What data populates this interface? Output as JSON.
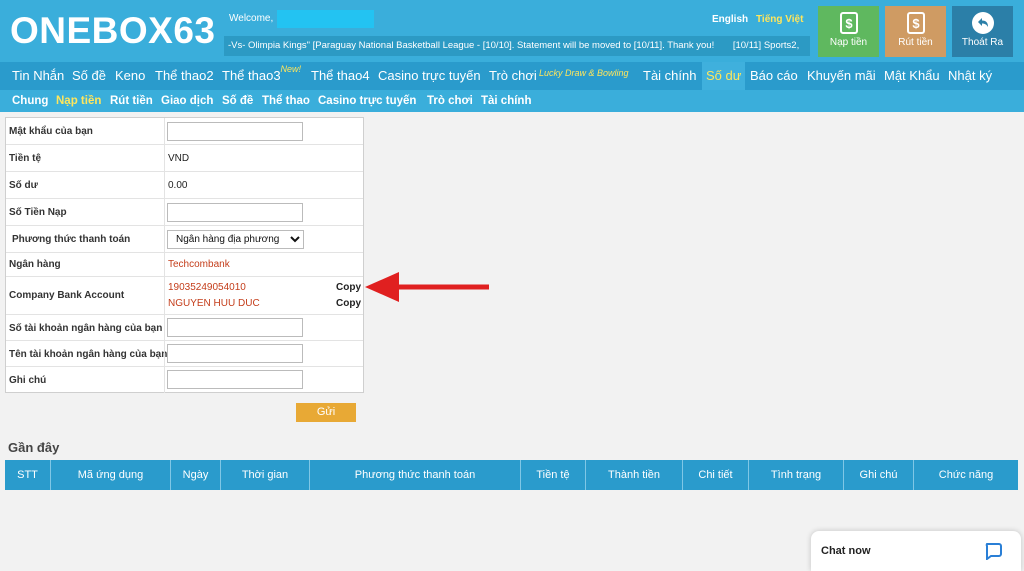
{
  "header": {
    "logo": "ONEBOX63",
    "welcome": "Welcome,",
    "ticker": [
      "-Vs- Olimpia Kings\" [Paraguay National Basketball League - [10/10]. Statement will be moved to [10/11]. Thank you!",
      "[10/11] Sports2,"
    ],
    "lang_en": "English",
    "lang_vi": "Tiếng Việt",
    "buttons": {
      "deposit": "Nạp tiền",
      "withdraw": "Rút tiền",
      "logout": "Thoát Ra"
    }
  },
  "nav1": {
    "items": [
      "Tin Nhắn",
      "Số đề",
      "Keno",
      "Thể thao2",
      "Thể thao3",
      "Thể thao4",
      "Casino trực tuyến",
      "Trò chơi",
      "Tài chính",
      "Số dư",
      "Báo cáo",
      "Khuyến mãi",
      "Mật Khẩu",
      "Nhật ký"
    ],
    "new_badge": "New!",
    "lucky": "Lucky Draw & Bowling",
    "active": "Số dư"
  },
  "nav2": {
    "items": [
      "Chung",
      "Nạp tiền",
      "Rút tiền",
      "Giao dịch",
      "Số đề",
      "Thể thao",
      "Casino trực tuyến",
      "Trò chơi",
      "Tài chính"
    ],
    "active": "Nạp tiền"
  },
  "form": {
    "password_label": "Mật khẩu của bạn",
    "currency_label": "Tiền tệ",
    "currency_value": "VND",
    "balance_label": "Số dư",
    "balance_value": "0.00",
    "amount_label": "Số Tiền Nạp",
    "method_label": "Phương thức thanh toán",
    "method_value": "Ngân hàng địa phương",
    "bank_label": "Ngân hàng",
    "bank_value": "Techcombank",
    "company_label": "Company Bank Account",
    "account_number": "19035249054010",
    "account_name": "NGUYEN HUU DUC",
    "copy_label": "Copy",
    "user_account_label": "Số tài khoản ngân hàng của bạn",
    "user_name_label": "Tên tài khoản ngân hàng của bạn",
    "note_label": "Ghi chú",
    "submit": "Gửi"
  },
  "recent": {
    "title": "Gần đây",
    "columns": [
      "STT",
      "Mã ứng dụng",
      "Ngày",
      "Thời gian",
      "Phương thức thanh toán",
      "Tiền tệ",
      "Thành tiền",
      "Chi tiết",
      "Tình trạng",
      "Ghi chú",
      "Chức năng"
    ]
  },
  "chat": {
    "label": "Chat now"
  },
  "colors": {
    "header": "#3aaedb",
    "nav": "#2a9bcc",
    "accent_yellow": "#ffe65c",
    "submit": "#e8a935",
    "arrow": "#e02020"
  }
}
